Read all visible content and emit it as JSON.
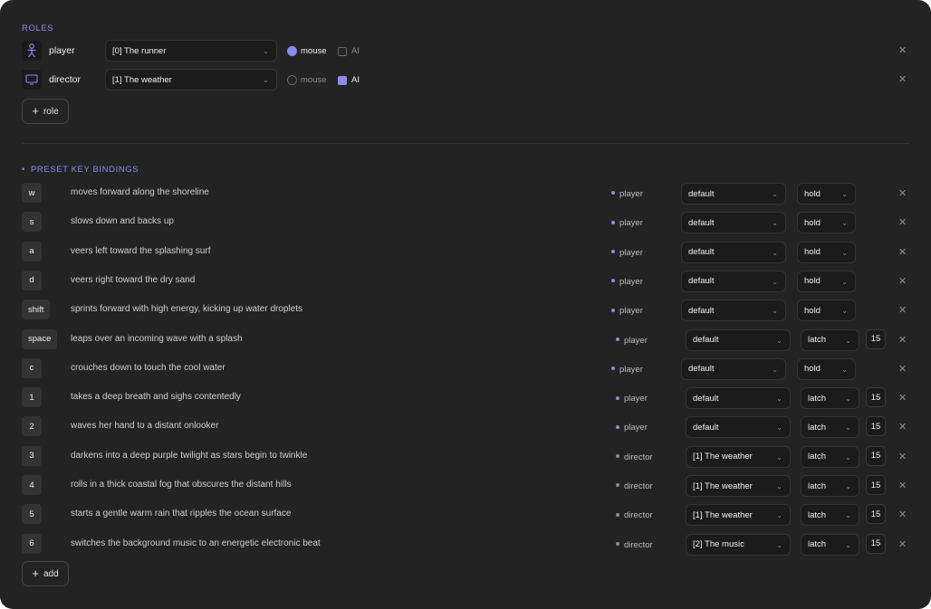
{
  "roles_title": "ROLES",
  "roles": [
    {
      "name": "player",
      "icon": "person-icon",
      "assignment": "[0] The runner",
      "mouse_label": "mouse",
      "mouse_selected": true,
      "ai_label": "AI",
      "ai_checked": false
    },
    {
      "name": "director",
      "icon": "monitor-icon",
      "assignment": "[1] The weather",
      "mouse_label": "mouse",
      "mouse_selected": false,
      "ai_label": "AI",
      "ai_checked": true
    }
  ],
  "add_role_label": "role",
  "bindings_title": "PRESET KEY BINDINGS",
  "bindings": [
    {
      "key": "w",
      "description": "moves forward along the shoreline",
      "role": "player",
      "target": "default",
      "mode": "hold",
      "value": ""
    },
    {
      "key": "s",
      "description": "slows down and backs up",
      "role": "player",
      "target": "default",
      "mode": "hold",
      "value": ""
    },
    {
      "key": "a",
      "description": "veers left toward the splashing surf",
      "role": "player",
      "target": "default",
      "mode": "hold",
      "value": ""
    },
    {
      "key": "d",
      "description": "veers right toward the dry sand",
      "role": "player",
      "target": "default",
      "mode": "hold",
      "value": ""
    },
    {
      "key": "shift",
      "description": "sprints forward with high energy, kicking up water droplets",
      "role": "player",
      "target": "default",
      "mode": "hold",
      "value": ""
    },
    {
      "key": "space",
      "description": "leaps over an incoming wave with a splash",
      "role": "player",
      "target": "default",
      "mode": "latch",
      "value": "15"
    },
    {
      "key": "c",
      "description": "crouches down to touch the cool water",
      "role": "player",
      "target": "default",
      "mode": "hold",
      "value": ""
    },
    {
      "key": "1",
      "description": "takes a deep breath and sighs contentedly",
      "role": "player",
      "target": "default",
      "mode": "latch",
      "value": "15"
    },
    {
      "key": "2",
      "description": "waves her hand to a distant onlooker",
      "role": "player",
      "target": "default",
      "mode": "latch",
      "value": "15"
    },
    {
      "key": "3",
      "description": "darkens into a deep purple twilight as stars begin to twinkle",
      "role": "director",
      "target": "[1] The weather",
      "mode": "latch",
      "value": "15"
    },
    {
      "key": "4",
      "description": "rolls in a thick coastal fog that obscures the distant hills",
      "role": "director",
      "target": "[1] The weather",
      "mode": "latch",
      "value": "15"
    },
    {
      "key": "5",
      "description": "starts a gentle warm rain that ripples the ocean surface",
      "role": "director",
      "target": "[1] The weather",
      "mode": "latch",
      "value": "15"
    },
    {
      "key": "6",
      "description": "switches the background music to an energetic electronic beat",
      "role": "director",
      "target": "[2] The music",
      "mode": "latch",
      "value": "15"
    }
  ],
  "add_binding_label": "add",
  "colors": {
    "accent": "#8a8cf0",
    "panel": "#232323",
    "control": "#1b1b1b"
  }
}
